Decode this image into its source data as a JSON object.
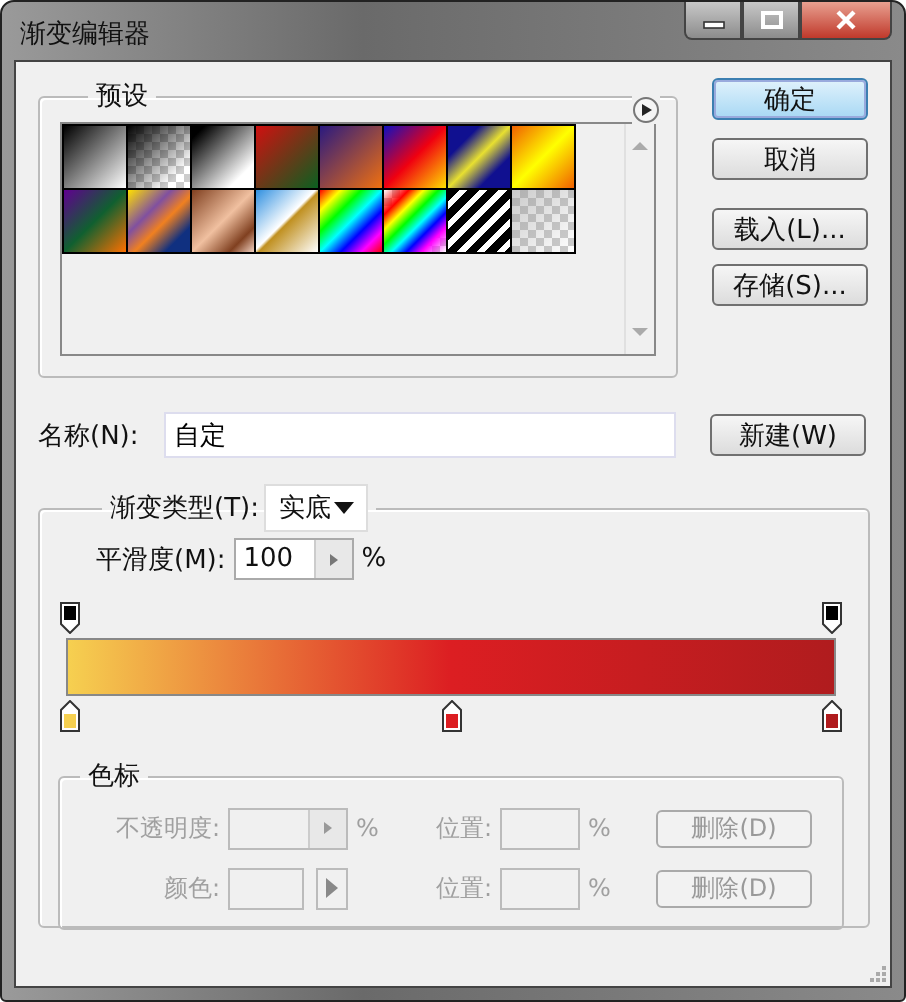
{
  "window": {
    "title": "渐变编辑器"
  },
  "presets": {
    "label": "预设"
  },
  "buttons": [
    {
      "label": "确定",
      "default": true
    },
    {
      "label": "取消",
      "default": false
    },
    {
      "label": "载入(L)...",
      "default": false
    },
    {
      "label": "存储(S)...",
      "default": false
    }
  ],
  "name_field": {
    "label": "名称(N):",
    "value": "自定",
    "button": "新建(W)"
  },
  "gradient_type": {
    "label": "渐变类型(T):",
    "value": "实底"
  },
  "smoothness": {
    "label": "平滑度(M):",
    "value": "100",
    "unit": "%"
  },
  "opacity_stops": [
    {
      "color": "#000000"
    },
    {
      "color": "#000000"
    }
  ],
  "color_stops": [
    {
      "color": "#f6d050"
    },
    {
      "color": "#dc1e22"
    },
    {
      "color": "#b01c1e"
    }
  ],
  "stops_panel": {
    "label": "色标",
    "rows": [
      {
        "kind": "opacity",
        "label": "不透明度:",
        "unit": "%",
        "position_label": "位置:",
        "position_unit": "%",
        "delete": "删除(D)",
        "disabled": true
      },
      {
        "kind": "color",
        "label": "颜色:",
        "position_label": "位置:",
        "position_unit": "%",
        "delete": "删除(D)",
        "disabled": true
      }
    ]
  }
}
